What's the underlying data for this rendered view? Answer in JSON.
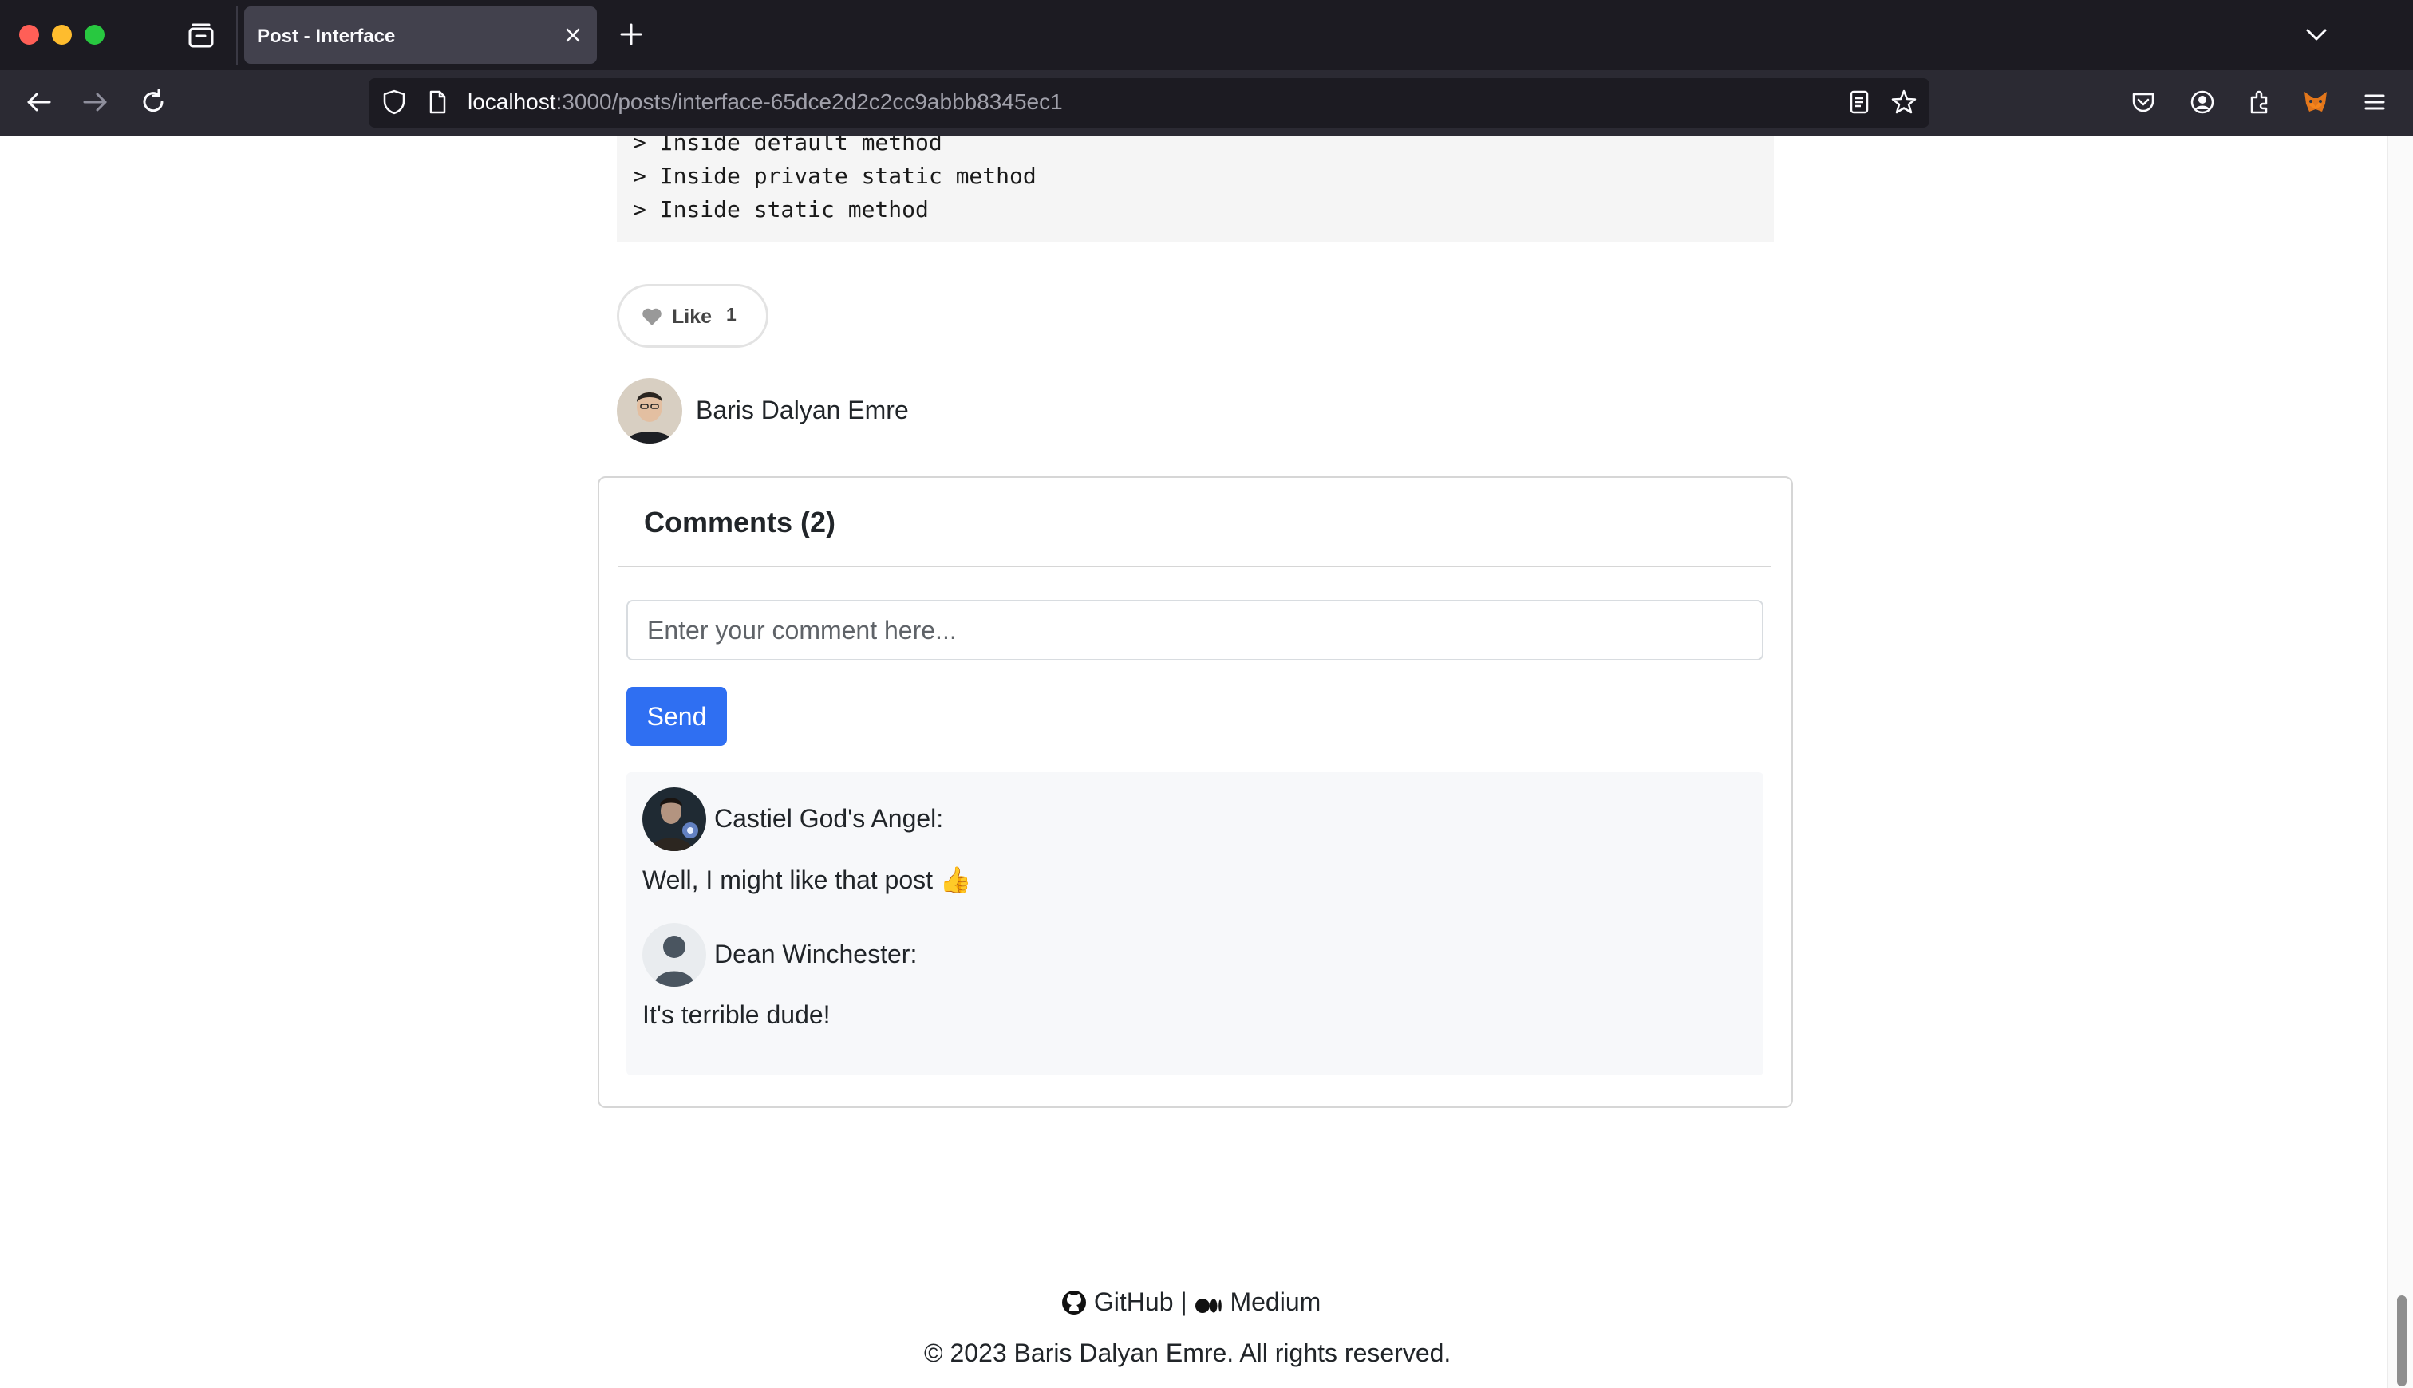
{
  "browser": {
    "tab_title": "Post - Interface",
    "url_host": "localhost",
    "url_path": ":3000/posts/interface-65dce2d2c2cc9abbb8345ec1"
  },
  "code": {
    "lines": [
      "> Inside default method",
      "> Inside private static method",
      "> Inside static method"
    ]
  },
  "like": {
    "label": "Like",
    "count": "1"
  },
  "author": {
    "name": "Baris Dalyan Emre"
  },
  "comments": {
    "title": "Comments (2)",
    "input_placeholder": "Enter your comment here...",
    "send_label": "Send",
    "items": [
      {
        "author": "Castiel God's Angel:",
        "text": "Well, I might like that post 👍"
      },
      {
        "author": "Dean Winchester:",
        "text": "It's terrible dude!"
      }
    ]
  },
  "footer": {
    "github_label": "GitHub",
    "separator": "|",
    "medium_label": "Medium",
    "copyright": "© 2023 Baris Dalyan Emre. All rights reserved."
  },
  "colors": {
    "accent": "#2f6ff2",
    "chrome_dark": "#1c1b22",
    "chrome_nav": "#2b2a33"
  }
}
